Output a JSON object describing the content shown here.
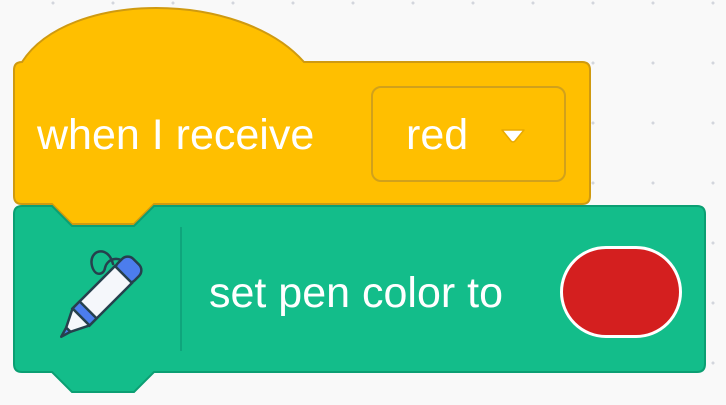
{
  "hat_block": {
    "label": "when I receive",
    "dropdown_value": "red",
    "dropdown_icon": "caret-down-icon",
    "fill_color": "#ffbf00",
    "stroke_color": "#cf9a10"
  },
  "pen_block": {
    "icon": "pen-icon",
    "label": "set pen color to",
    "color_value": "#d41f1f",
    "fill_color": "#13bd8a",
    "stroke_color": "#0b9f73"
  }
}
